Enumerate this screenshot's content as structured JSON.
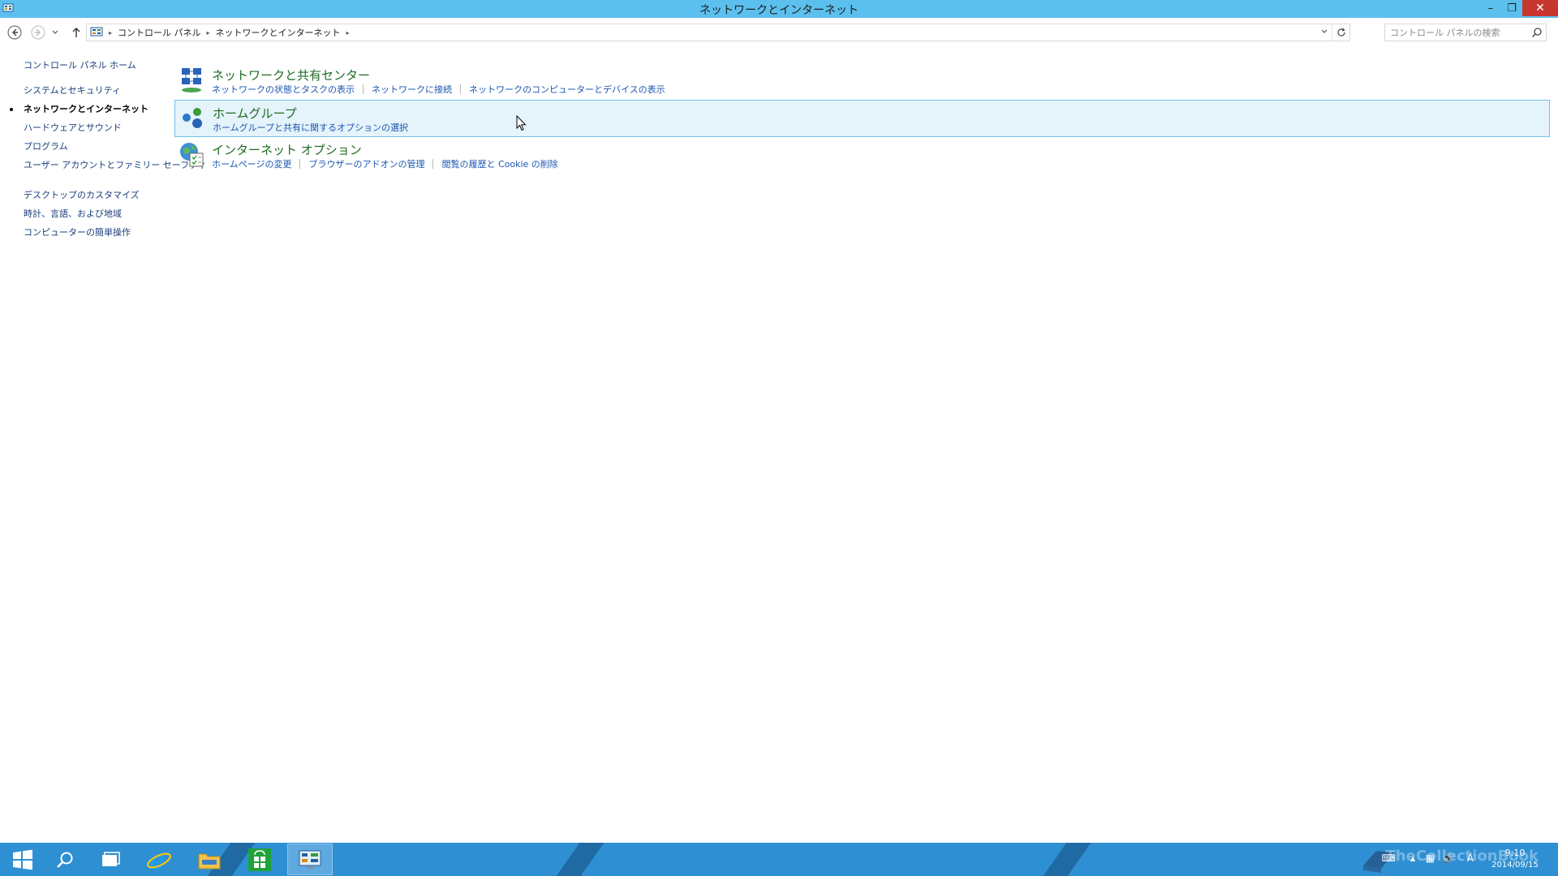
{
  "window": {
    "title": "ネットワークとインターネット",
    "minimize_glyph": "–",
    "maximize_glyph": "❐",
    "close_glyph": "✕"
  },
  "address_bar": {
    "crumbs": [
      "コントロール パネル",
      "ネットワークとインターネット"
    ],
    "separator": "▸"
  },
  "search": {
    "placeholder": "コントロール パネルの検索"
  },
  "left_nav": {
    "home": "コントロール パネル ホーム",
    "items": [
      {
        "label": "システムとセキュリティ",
        "active": false
      },
      {
        "label": "ネットワークとインターネット",
        "active": true
      },
      {
        "label": "ハードウェアとサウンド",
        "active": false
      },
      {
        "label": "プログラム",
        "active": false
      },
      {
        "label": "ユーザー アカウントとファミリー セーフティ",
        "active": false
      },
      {
        "label": "デスクトップのカスタマイズ",
        "active": false
      },
      {
        "label": "時計、言語、および地域",
        "active": false
      },
      {
        "label": "コンピューターの簡単操作",
        "active": false
      }
    ]
  },
  "categories": [
    {
      "title": "ネットワークと共有センター",
      "icon": "network-sharing-icon",
      "links": [
        "ネットワークの状態とタスクの表示",
        "ネットワークに接続",
        "ネットワークのコンピューターとデバイスの表示"
      ]
    },
    {
      "title": "ホームグループ",
      "icon": "homegroup-icon",
      "links": [
        "ホームグループと共有に関するオプションの選択"
      ]
    },
    {
      "title": "インターネット オプション",
      "icon": "internet-options-icon",
      "links": [
        "ホームページの変更",
        "ブラウザーのアドオンの管理",
        "閲覧の履歴と Cookie の削除"
      ]
    }
  ],
  "taskbar": {
    "apps": [
      "start-button",
      "search-charm",
      "task-view",
      "internet-explorer",
      "file-explorer",
      "store",
      "control-panel"
    ],
    "clock_time": "9:10",
    "clock_date": "2014/09/15",
    "ime": "A",
    "watermark": "TheCollectionBook"
  },
  "colors": {
    "titlebar": "#5bc0ee",
    "taskbar": "#2f8fd3",
    "link": "#1a56b0",
    "category_title": "#1e6b22",
    "hover_bg": "#e5f3fb",
    "hover_border": "#70c0e7"
  }
}
